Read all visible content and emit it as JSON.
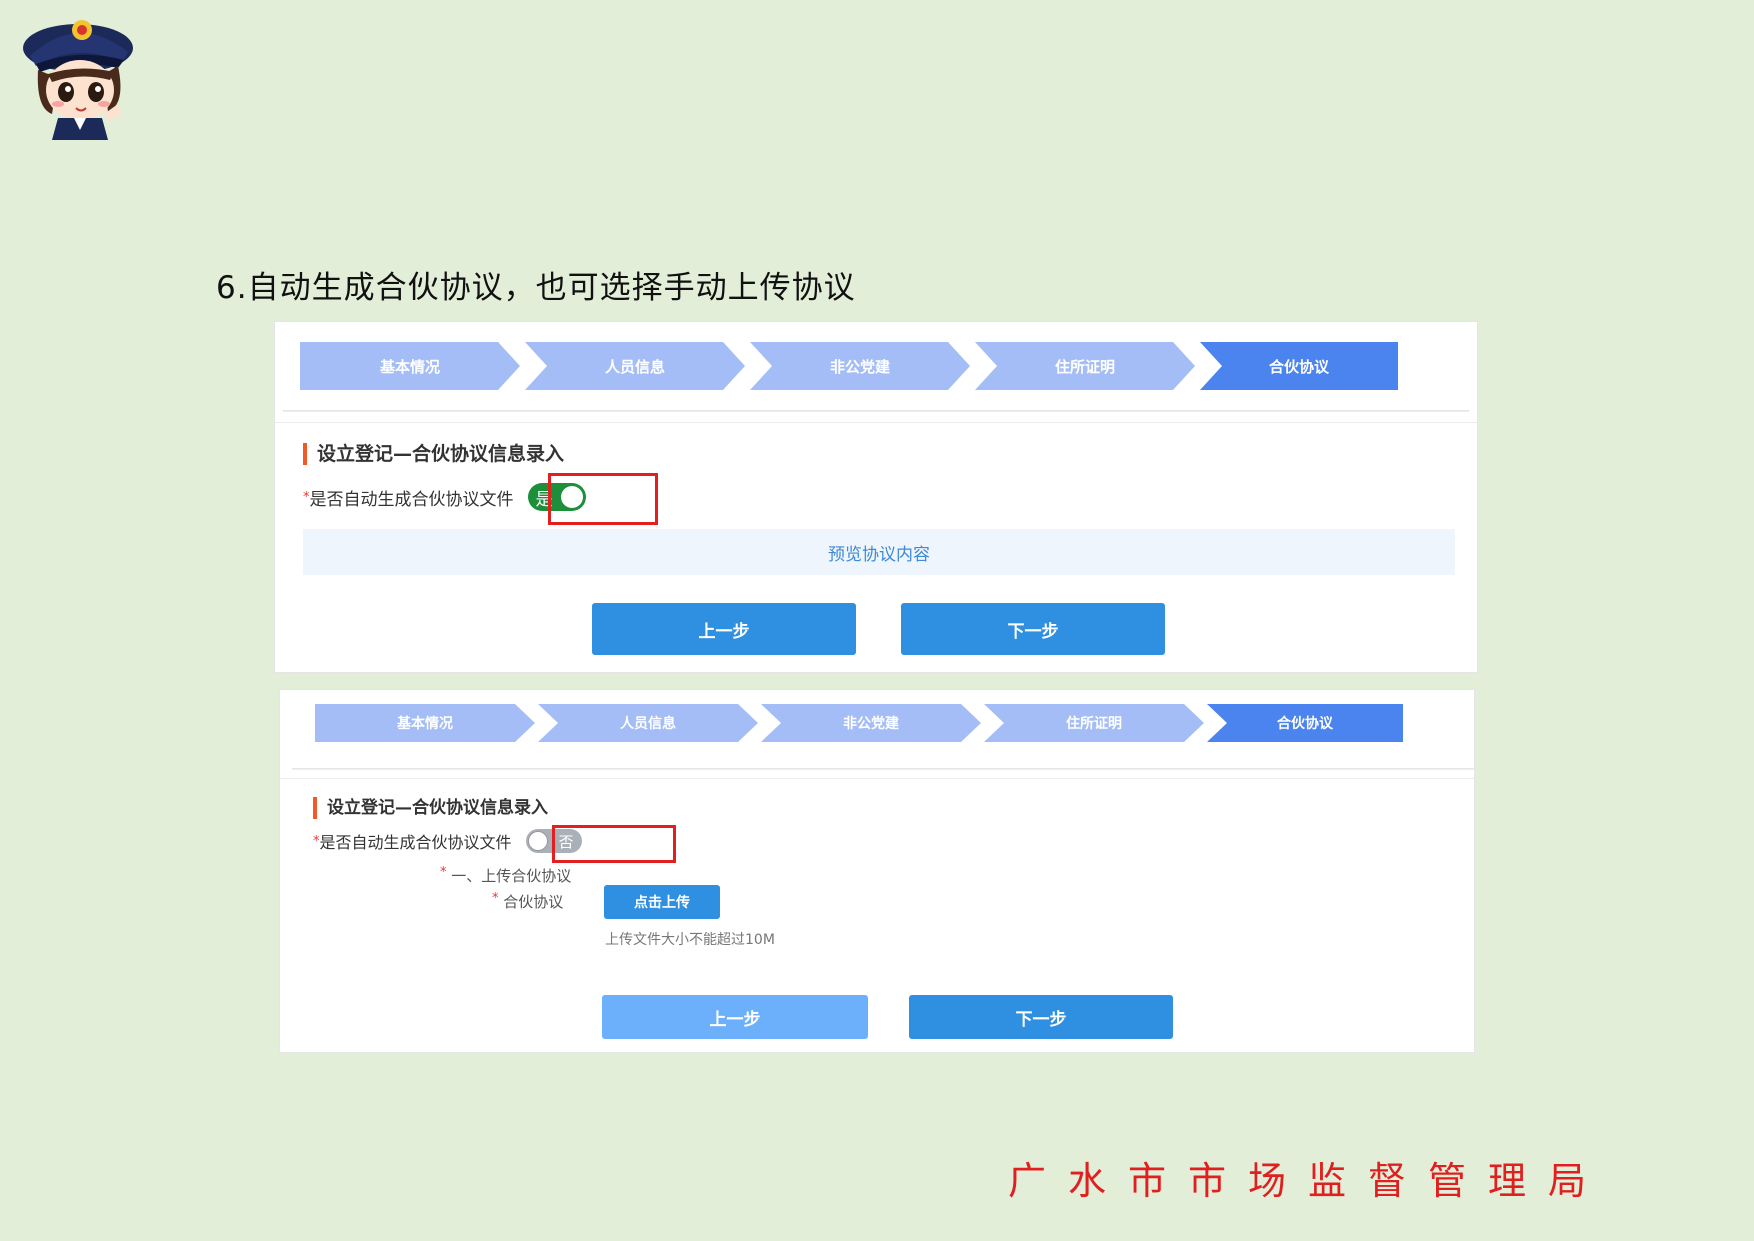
{
  "heading": "6.自动生成合伙协议，也可选择手动上传协议",
  "steps": [
    {
      "label": "基本情况"
    },
    {
      "label": "人员信息"
    },
    {
      "label": "非公党建"
    },
    {
      "label": "住所证明"
    },
    {
      "label": "合伙协议"
    }
  ],
  "active_step": "合伙协议",
  "panel1": {
    "section_title": "设立登记—合伙协议信息录入",
    "switch_label": "是否自动生成合伙协议文件",
    "toggle_text": "是",
    "preview_label": "预览协议内容",
    "prev_button": "上一步",
    "next_button": "下一步"
  },
  "panel2": {
    "section_title": "设立登记—合伙协议信息录入",
    "switch_label": "是否自动生成合伙协议文件",
    "toggle_text": "否",
    "upload_section_label": "一、上传合伙协议",
    "upload_field_label": "合伙协议",
    "upload_button": "点击上传",
    "upload_hint": "上传文件大小不能超过10M",
    "prev_button": "上一步",
    "next_button": "下一步"
  },
  "footer": "广水市市场监督管理局",
  "colors": {
    "background": "#e2eed8",
    "step_inactive": "#a4bdf6",
    "step_active": "#4b83ef",
    "toggle_on": "#1d8f3a",
    "button": "#2f8fe0",
    "highlight": "#e32020",
    "footer_text": "#e02020"
  }
}
